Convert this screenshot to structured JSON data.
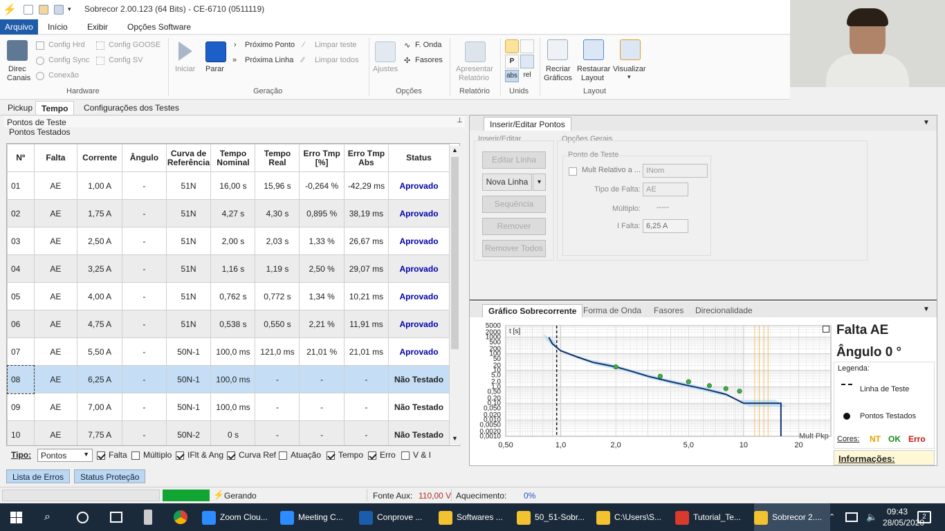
{
  "window": {
    "title": "Sobrecor 2.00.123 (64 Bits) - CE-6710 (0511119)"
  },
  "menu": [
    "Arquivo",
    "Início",
    "Exibir",
    "Opções Software"
  ],
  "ribbon": {
    "hardware": {
      "direc": "Direc",
      "canais": "Canais",
      "config_hrd": "Config Hrd",
      "config_sync": "Config Sync",
      "conexao": "Conexão",
      "config_goose": "Config GOOSE",
      "config_sv": "Config SV",
      "group": "Hardware"
    },
    "geracao": {
      "iniciar": "Iniciar",
      "parar": "Parar",
      "proximo_ponto": "Próximo Ponto",
      "proxima_linha": "Próxima Linha",
      "limpar_teste": "Limpar teste",
      "limpar_todos": "Limpar todos",
      "group": "Geração"
    },
    "opcoes": {
      "ajustes": "Ajustes",
      "f_onda": "F. Onda",
      "fasores": "Fasores",
      "group": "Opções"
    },
    "relatorio": {
      "apresentar": "Apresentar",
      "relatorio": "Relatório",
      "group": "Relatório"
    },
    "unids": {
      "abs": "abs",
      "rel": "rel",
      "group": "Unids"
    },
    "layout": {
      "recriar": "Recriar",
      "graficos": "Gráficos",
      "restaurar": "Restaurar",
      "layout": "Layout",
      "visualizar": "Visualizar",
      "group": "Layout"
    }
  },
  "tabs": [
    "Pickup",
    "Tempo",
    "Configurações dos Testes"
  ],
  "panel": {
    "title": "Pontos de Teste",
    "subtitle": "Pontos Testados"
  },
  "table": {
    "headers": [
      [
        "Nº"
      ],
      [
        "Falta"
      ],
      [
        "Corrente"
      ],
      [
        "Ângulo"
      ],
      [
        "Curva de",
        "Referência"
      ],
      [
        "Tempo",
        "Nominal"
      ],
      [
        "Tempo",
        "Real"
      ],
      [
        "Erro Tmp",
        "[%]"
      ],
      [
        "Erro Tmp",
        "Abs"
      ],
      [
        "Status"
      ]
    ],
    "rows": [
      [
        "01",
        "AE",
        "1,00 A",
        "-",
        "51N",
        "16,00 s",
        "15,96 s",
        "-0,264 %",
        "-42,29 ms",
        "Aprovado"
      ],
      [
        "02",
        "AE",
        "1,75 A",
        "-",
        "51N",
        "4,27 s",
        "4,30 s",
        "0,895 %",
        "38,19 ms",
        "Aprovado"
      ],
      [
        "03",
        "AE",
        "2,50 A",
        "-",
        "51N",
        "2,00 s",
        "2,03 s",
        "1,33 %",
        "26,67 ms",
        "Aprovado"
      ],
      [
        "04",
        "AE",
        "3,25 A",
        "-",
        "51N",
        "1,16 s",
        "1,19 s",
        "2,50 %",
        "29,07 ms",
        "Aprovado"
      ],
      [
        "05",
        "AE",
        "4,00 A",
        "-",
        "51N",
        "0,762 s",
        "0,772 s",
        "1,34 %",
        "10,21 ms",
        "Aprovado"
      ],
      [
        "06",
        "AE",
        "4,75 A",
        "-",
        "51N",
        "0,538 s",
        "0,550 s",
        "2,21 %",
        "11,91 ms",
        "Aprovado"
      ],
      [
        "07",
        "AE",
        "5,50 A",
        "-",
        "50N-1",
        "100,0 ms",
        "121,0 ms",
        "21,01 %",
        "21,01 ms",
        "Aprovado"
      ],
      [
        "08",
        "AE",
        "6,25 A",
        "-",
        "50N-1",
        "100,0 ms",
        "-",
        "-",
        "-",
        "Não Testado"
      ],
      [
        "09",
        "AE",
        "7,00 A",
        "-",
        "50N-1",
        "100,0 ms",
        "-",
        "-",
        "-",
        "Não Testado"
      ],
      [
        "10",
        "AE",
        "7,75 A",
        "-",
        "50N-2",
        "0 s",
        "-",
        "-",
        "-",
        "Não Testado"
      ]
    ]
  },
  "tipo": {
    "label": "Tipo:",
    "select": "Pontos",
    "options": [
      {
        "label": "Falta",
        "on": true
      },
      {
        "label": "Múltiplo",
        "on": false
      },
      {
        "label": "IFlt & Ang",
        "on": true
      },
      {
        "label": "Curva Ref",
        "on": true
      },
      {
        "label": "Atuação",
        "on": false
      },
      {
        "label": "Tempo",
        "on": true
      },
      {
        "label": "Erro",
        "on": true
      },
      {
        "label": "V & I",
        "on": false
      }
    ]
  },
  "bottom_tabs": [
    "Lista de Erros",
    "Status Proteção"
  ],
  "inserir": {
    "tab": "Inserir/Editar Pontos",
    "group1": "Inserir/Editar",
    "editar_linha": "Editar Linha",
    "nova_linha": "Nova Linha",
    "sequencia": "Sequência",
    "remover": "Remover",
    "remover_todos": "Remover Todos",
    "group2": "Opções Gerais",
    "ponto": "Ponto de Teste",
    "mult_rel": "Mult Relativo a ...",
    "mult_rel_val": "INom",
    "tipo_falta": "Tipo de Falta:",
    "tipo_falta_val": "AE",
    "multiplo": "Múltiplo:",
    "multiplo_val": "-----",
    "ifalta": "I Falta:",
    "ifalta_val": "6,25 A"
  },
  "graph_tabs": [
    "Gráfico Sobrecorrente",
    "Forma de Onda",
    "Fasores",
    "Direcionalidade"
  ],
  "graph": {
    "unit": "t [s]",
    "xaxis_label": "Mult Pkp",
    "y_ticks": [
      "5000",
      "2000",
      "1000",
      "500",
      "200",
      "100",
      "50",
      "20",
      "10",
      "5,0",
      "2,0",
      "1,0",
      "0,50",
      "0,20",
      "0,10",
      "0,050",
      "0,020",
      "0,010",
      "0,0050",
      "0,0020",
      "0,0010"
    ],
    "x_ticks": [
      "0,50",
      "1,0",
      "2,0",
      "5,0",
      "10",
      "20"
    ],
    "falta": "Falta AE",
    "angulo": "Ângulo 0 °",
    "legenda": "Legenda:",
    "linha_teste": "Linha de Teste",
    "pontos_testados": "Pontos Testados",
    "cores": "Cores:",
    "nt": "NT",
    "ok": "OK",
    "erro": "Erro",
    "informacoes": "Informações:"
  },
  "chart_data": {
    "type": "line",
    "xscale": "log",
    "yscale": "log",
    "title": "",
    "xlabel": "Mult Pkp",
    "ylabel": "t [s]",
    "xlim": [
      0.5,
      30
    ],
    "ylim": [
      0.001,
      5000
    ],
    "grid": true,
    "series": [
      {
        "name": "",
        "x": [
          0.86,
          0.9,
          1.0,
          1.25,
          1.5,
          2.0,
          2.5,
          3.0,
          4.0,
          5.0,
          6.0,
          8.0,
          10.0,
          10.0,
          16.0,
          16.0
        ],
        "y": [
          1000,
          400,
          150,
          60,
          30,
          16,
          8,
          4.3,
          2.0,
          1.16,
          0.76,
          0.35,
          0.1,
          0.1,
          0.1,
          0.001
        ]
      },
      {
        "name": "Pontos Testados",
        "x": [
          2.0,
          3.5,
          5.0,
          6.5,
          8.0,
          9.5
        ],
        "y": [
          16.0,
          4.3,
          2.0,
          1.16,
          0.762,
          0.538
        ]
      }
    ],
    "test_line_x": 0.95
  },
  "status": {
    "gerando": "Gerando",
    "fonte_label": "Fonte Aux:",
    "fonte_val": "110,00 V",
    "aquec_label": "Aquecimento:",
    "aquec_val": "0%"
  },
  "taskbar": {
    "apps": [
      "Zoom Clou...",
      "Meeting C...",
      "Conprove ...",
      "Softwares ...",
      "50_51-Sobr...",
      "C:\\Users\\S...",
      "Tutorial_Te...",
      "Sobrecor 2...."
    ],
    "time": "09:43",
    "date": "28/05/2020",
    "notif": "2"
  },
  "colors": {
    "accent": "#1e5ba8",
    "approved": "#0000aa",
    "selected_row": "#c5def5",
    "curve": "#12306b",
    "point": "#3cb043",
    "nt": "#e8a000",
    "ok": "#1a8a1a",
    "erro": "#cc1111"
  }
}
